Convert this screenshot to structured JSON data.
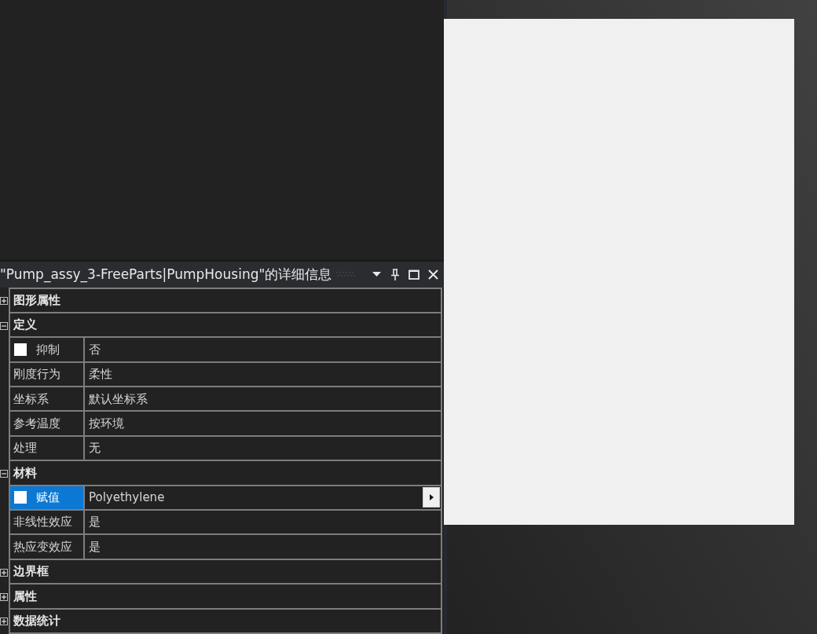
{
  "panel": {
    "title": "\"Pump_assy_3-FreeParts|PumpHousing\"的详细信息"
  },
  "groups": [
    {
      "name": "图形属性",
      "expanded": false
    },
    {
      "name": "定义",
      "expanded": true,
      "rows": [
        {
          "kind": "checkbox",
          "label": "抑制",
          "checked": false,
          "value": "否",
          "selected": false
        },
        {
          "kind": "plain",
          "label": "刚度行为",
          "value": "柔性",
          "selected": false
        },
        {
          "kind": "plain",
          "label": "坐标系",
          "value": "默认坐标系",
          "selected": false
        },
        {
          "kind": "plain",
          "label": "参考温度",
          "value": "按环境",
          "selected": false
        },
        {
          "kind": "plain",
          "label": "处理",
          "value": "无",
          "selected": false
        }
      ]
    },
    {
      "name": "材料",
      "expanded": true,
      "rows": [
        {
          "kind": "checkbox_flyout",
          "label": "赋值",
          "checked": false,
          "value": "Polyethylene",
          "selected": true
        },
        {
          "kind": "plain",
          "label": "非线性效应",
          "value": "是",
          "selected": false
        },
        {
          "kind": "plain",
          "label": "热应变效应",
          "value": "是",
          "selected": false
        }
      ]
    },
    {
      "name": "边界框",
      "expanded": false
    },
    {
      "name": "属性",
      "expanded": false
    },
    {
      "name": "数据统计",
      "expanded": false
    }
  ]
}
